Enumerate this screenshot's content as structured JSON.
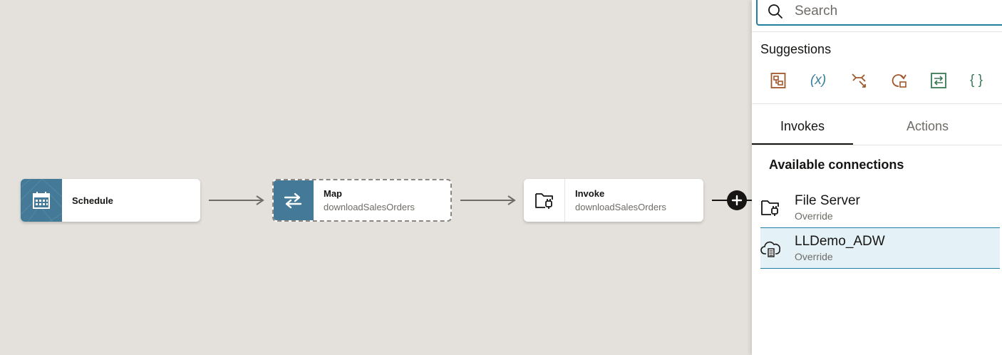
{
  "canvas": {
    "nodes": [
      {
        "title": "Schedule",
        "subtitle": ""
      },
      {
        "title": "Map",
        "subtitle": "downloadSalesOrders"
      },
      {
        "title": "Invoke",
        "subtitle": "downloadSalesOrders"
      }
    ]
  },
  "panel": {
    "search_placeholder": "Search",
    "suggestions_title": "Suggestions",
    "suggestions": [
      {
        "icon": "assign-icon",
        "label": "",
        "color": "#a2572a"
      },
      {
        "icon": "variable-icon",
        "label": "(x)",
        "color": "#3a7f9c"
      },
      {
        "icon": "switch-icon",
        "label": "",
        "color": "#a2572a"
      },
      {
        "icon": "for-each-icon",
        "label": "",
        "color": "#a2572a"
      },
      {
        "icon": "map-icon",
        "label": "",
        "color": "#3b7a57"
      },
      {
        "icon": "json-icon",
        "label": "{ }",
        "color": "#3b7a57"
      }
    ],
    "tabs": [
      {
        "label": "Invokes",
        "active": true
      },
      {
        "label": "Actions",
        "active": false
      }
    ],
    "available_title": "Available connections",
    "connections": [
      {
        "name": "File Server",
        "sub": "Override",
        "icon": "folder-plug-icon",
        "selected": false
      },
      {
        "name": "LLDemo_ADW",
        "sub": "Override",
        "icon": "cloud-database-icon",
        "selected": true
      }
    ]
  },
  "colors": {
    "accent": "#227e9e",
    "node_teal": "#447a97",
    "canvas": "#e4e1dc"
  }
}
